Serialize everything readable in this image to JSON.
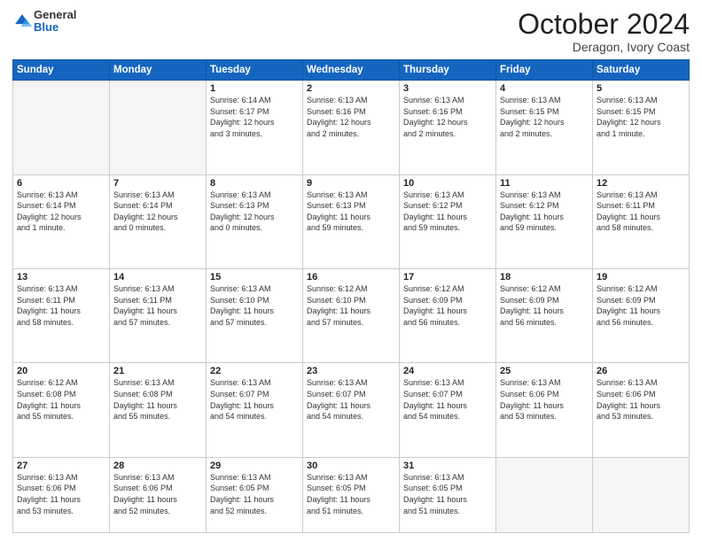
{
  "header": {
    "logo": {
      "general": "General",
      "blue": "Blue"
    },
    "title": "October 2024",
    "location": "Deragon, Ivory Coast"
  },
  "days_of_week": [
    "Sunday",
    "Monday",
    "Tuesday",
    "Wednesday",
    "Thursday",
    "Friday",
    "Saturday"
  ],
  "weeks": [
    [
      {
        "day": "",
        "info": ""
      },
      {
        "day": "",
        "info": ""
      },
      {
        "day": "1",
        "info": "Sunrise: 6:14 AM\nSunset: 6:17 PM\nDaylight: 12 hours\nand 3 minutes."
      },
      {
        "day": "2",
        "info": "Sunrise: 6:13 AM\nSunset: 6:16 PM\nDaylight: 12 hours\nand 2 minutes."
      },
      {
        "day": "3",
        "info": "Sunrise: 6:13 AM\nSunset: 6:16 PM\nDaylight: 12 hours\nand 2 minutes."
      },
      {
        "day": "4",
        "info": "Sunrise: 6:13 AM\nSunset: 6:15 PM\nDaylight: 12 hours\nand 2 minutes."
      },
      {
        "day": "5",
        "info": "Sunrise: 6:13 AM\nSunset: 6:15 PM\nDaylight: 12 hours\nand 1 minute."
      }
    ],
    [
      {
        "day": "6",
        "info": "Sunrise: 6:13 AM\nSunset: 6:14 PM\nDaylight: 12 hours\nand 1 minute."
      },
      {
        "day": "7",
        "info": "Sunrise: 6:13 AM\nSunset: 6:14 PM\nDaylight: 12 hours\nand 0 minutes."
      },
      {
        "day": "8",
        "info": "Sunrise: 6:13 AM\nSunset: 6:13 PM\nDaylight: 12 hours\nand 0 minutes."
      },
      {
        "day": "9",
        "info": "Sunrise: 6:13 AM\nSunset: 6:13 PM\nDaylight: 11 hours\nand 59 minutes."
      },
      {
        "day": "10",
        "info": "Sunrise: 6:13 AM\nSunset: 6:12 PM\nDaylight: 11 hours\nand 59 minutes."
      },
      {
        "day": "11",
        "info": "Sunrise: 6:13 AM\nSunset: 6:12 PM\nDaylight: 11 hours\nand 59 minutes."
      },
      {
        "day": "12",
        "info": "Sunrise: 6:13 AM\nSunset: 6:11 PM\nDaylight: 11 hours\nand 58 minutes."
      }
    ],
    [
      {
        "day": "13",
        "info": "Sunrise: 6:13 AM\nSunset: 6:11 PM\nDaylight: 11 hours\nand 58 minutes."
      },
      {
        "day": "14",
        "info": "Sunrise: 6:13 AM\nSunset: 6:11 PM\nDaylight: 11 hours\nand 57 minutes."
      },
      {
        "day": "15",
        "info": "Sunrise: 6:13 AM\nSunset: 6:10 PM\nDaylight: 11 hours\nand 57 minutes."
      },
      {
        "day": "16",
        "info": "Sunrise: 6:12 AM\nSunset: 6:10 PM\nDaylight: 11 hours\nand 57 minutes."
      },
      {
        "day": "17",
        "info": "Sunrise: 6:12 AM\nSunset: 6:09 PM\nDaylight: 11 hours\nand 56 minutes."
      },
      {
        "day": "18",
        "info": "Sunrise: 6:12 AM\nSunset: 6:09 PM\nDaylight: 11 hours\nand 56 minutes."
      },
      {
        "day": "19",
        "info": "Sunrise: 6:12 AM\nSunset: 6:09 PM\nDaylight: 11 hours\nand 56 minutes."
      }
    ],
    [
      {
        "day": "20",
        "info": "Sunrise: 6:12 AM\nSunset: 6:08 PM\nDaylight: 11 hours\nand 55 minutes."
      },
      {
        "day": "21",
        "info": "Sunrise: 6:13 AM\nSunset: 6:08 PM\nDaylight: 11 hours\nand 55 minutes."
      },
      {
        "day": "22",
        "info": "Sunrise: 6:13 AM\nSunset: 6:07 PM\nDaylight: 11 hours\nand 54 minutes."
      },
      {
        "day": "23",
        "info": "Sunrise: 6:13 AM\nSunset: 6:07 PM\nDaylight: 11 hours\nand 54 minutes."
      },
      {
        "day": "24",
        "info": "Sunrise: 6:13 AM\nSunset: 6:07 PM\nDaylight: 11 hours\nand 54 minutes."
      },
      {
        "day": "25",
        "info": "Sunrise: 6:13 AM\nSunset: 6:06 PM\nDaylight: 11 hours\nand 53 minutes."
      },
      {
        "day": "26",
        "info": "Sunrise: 6:13 AM\nSunset: 6:06 PM\nDaylight: 11 hours\nand 53 minutes."
      }
    ],
    [
      {
        "day": "27",
        "info": "Sunrise: 6:13 AM\nSunset: 6:06 PM\nDaylight: 11 hours\nand 53 minutes."
      },
      {
        "day": "28",
        "info": "Sunrise: 6:13 AM\nSunset: 6:06 PM\nDaylight: 11 hours\nand 52 minutes."
      },
      {
        "day": "29",
        "info": "Sunrise: 6:13 AM\nSunset: 6:05 PM\nDaylight: 11 hours\nand 52 minutes."
      },
      {
        "day": "30",
        "info": "Sunrise: 6:13 AM\nSunset: 6:05 PM\nDaylight: 11 hours\nand 51 minutes."
      },
      {
        "day": "31",
        "info": "Sunrise: 6:13 AM\nSunset: 6:05 PM\nDaylight: 11 hours\nand 51 minutes."
      },
      {
        "day": "",
        "info": ""
      },
      {
        "day": "",
        "info": ""
      }
    ]
  ]
}
